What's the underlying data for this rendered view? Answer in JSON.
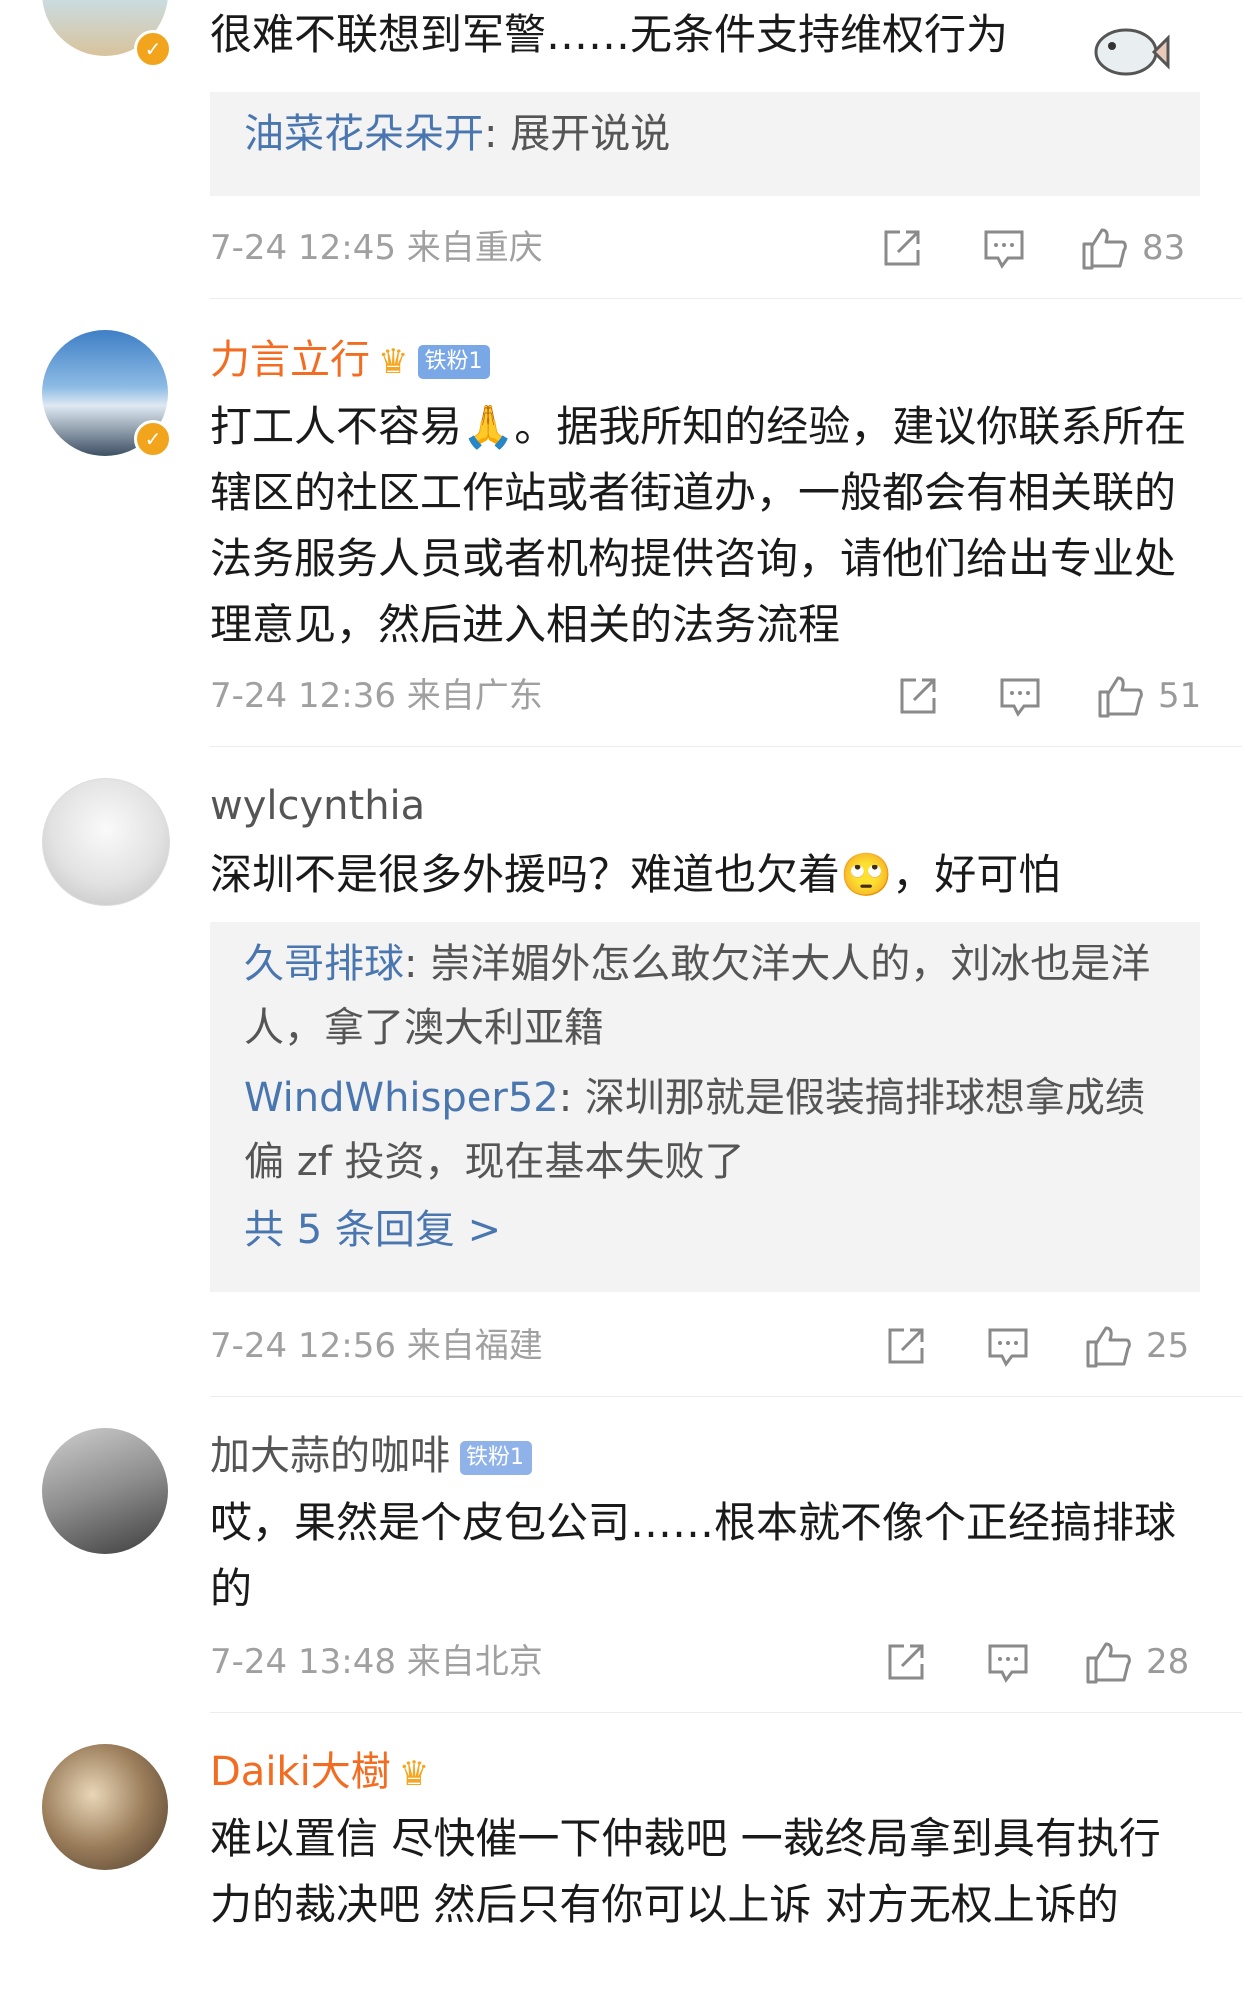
{
  "comments": [
    {
      "text": "很难不联想到军警……无条件支持维权行为",
      "replies": [
        {
          "name": "油菜花朵朵开",
          "text": ": 展开说说"
        }
      ],
      "date": "7-24 12:45",
      "location": "来自重庆",
      "likes": "83"
    },
    {
      "user": "力言立行",
      "badge": "铁粉1",
      "text": "打工人不容易🙏。据我所知的经验，建议你联系所在辖区的社区工作站或者街道办，一般都会有相关联的法务服务人员或者机构提供咨询，请他们给出专业处理意见，然后进入相关的法务流程",
      "date": "7-24 12:36",
      "location": "来自广东",
      "likes": "51"
    },
    {
      "user": "wylcynthia",
      "text": "深圳不是很多外援吗？难道也欠着🙄，好可怕",
      "replies": [
        {
          "name": "久哥排球",
          "text": ": 崇洋媚外怎么敢欠洋大人的，刘冰也是洋人，拿了澳大利亚籍"
        },
        {
          "name": "WindWhisper52",
          "text": ": 深圳那就是假装搞排球想拿成绩偏 zf 投资，现在基本失败了"
        }
      ],
      "more": "共 5 条回复 >",
      "date": "7-24 12:56",
      "location": "来自福建",
      "likes": "25"
    },
    {
      "user": "加大蒜的咖啡",
      "badge": "铁粉1",
      "text": "哎，果然是个皮包公司……根本就不像个正经搞排球的",
      "date": "7-24 13:48",
      "location": "来自北京",
      "likes": "28"
    },
    {
      "user": "Daiki大樹",
      "text": "难以置信 尽快催一下仲裁吧 一裁终局拿到具有执行力的裁决吧 然后只有你可以上诉 对方无权上诉的"
    }
  ],
  "icons": {
    "share": "share-icon",
    "comment": "comment-icon",
    "like": "thumbs-up-icon",
    "verified": "verified-badge-icon",
    "crown": "crown-icon"
  },
  "colors": {
    "username_orange": "#f26d22",
    "link_blue": "#4a76b0",
    "meta_gray": "#a0a0a0",
    "reply_bg": "#f3f3f3"
  }
}
